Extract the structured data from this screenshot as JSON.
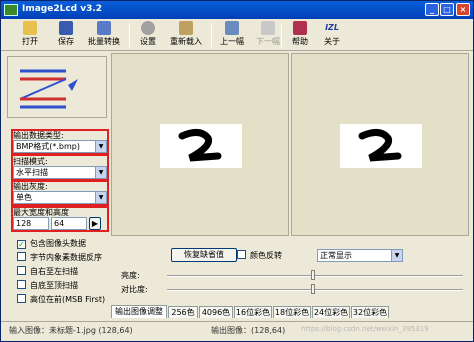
{
  "window": {
    "title": "Image2Lcd v3.2"
  },
  "toolbar": [
    {
      "label": "打开",
      "disabled": false
    },
    {
      "label": "保存",
      "disabled": false
    },
    {
      "label": "批量转换",
      "disabled": false
    },
    {
      "label": "设置",
      "disabled": false
    },
    {
      "label": "重新载入",
      "disabled": false
    },
    {
      "label": "上一幅",
      "disabled": false
    },
    {
      "label": "下一幅",
      "disabled": true
    },
    {
      "label": "帮助",
      "disabled": false
    },
    {
      "label": "关于",
      "disabled": false
    }
  ],
  "about_icon_text": "IZL",
  "settings": {
    "output_type_label": "输出数据类型:",
    "output_type_value": "BMP格式(*.bmp)",
    "scan_mode_label": "扫描模式:",
    "scan_mode_value": "水平扫描",
    "gray_label": "输出灰度:",
    "gray_value": "单色",
    "size_label": "最大宽度和高度",
    "width": "128",
    "height": "64"
  },
  "options": [
    {
      "label": "包含图像头数据",
      "checked": true
    },
    {
      "label": "字节内象素数据反序",
      "checked": false
    },
    {
      "label": "自右至左扫描",
      "checked": false
    },
    {
      "label": "自底至顶扫描",
      "checked": false
    },
    {
      "label": "高位在前(MSB First)",
      "checked": false
    }
  ],
  "adjust": {
    "restore_button": "恢复缺省值",
    "invert_label": "颜色反转",
    "display_mode": "正常显示",
    "brightness_label": "亮度:",
    "contrast_label": "对比度:",
    "brightness_level": 0.5,
    "contrast_level": 0.5
  },
  "tabs": [
    "输出图像调整",
    "256色",
    "4096色",
    "16位彩色",
    "18位彩色",
    "24位彩色",
    "32位彩色"
  ],
  "status": {
    "input": "输入图像：未标题-1.jpg (128,64)",
    "output": "输出图像：(128,64)",
    "watermark": "https://blog.csdn.net/weixin_395319"
  }
}
